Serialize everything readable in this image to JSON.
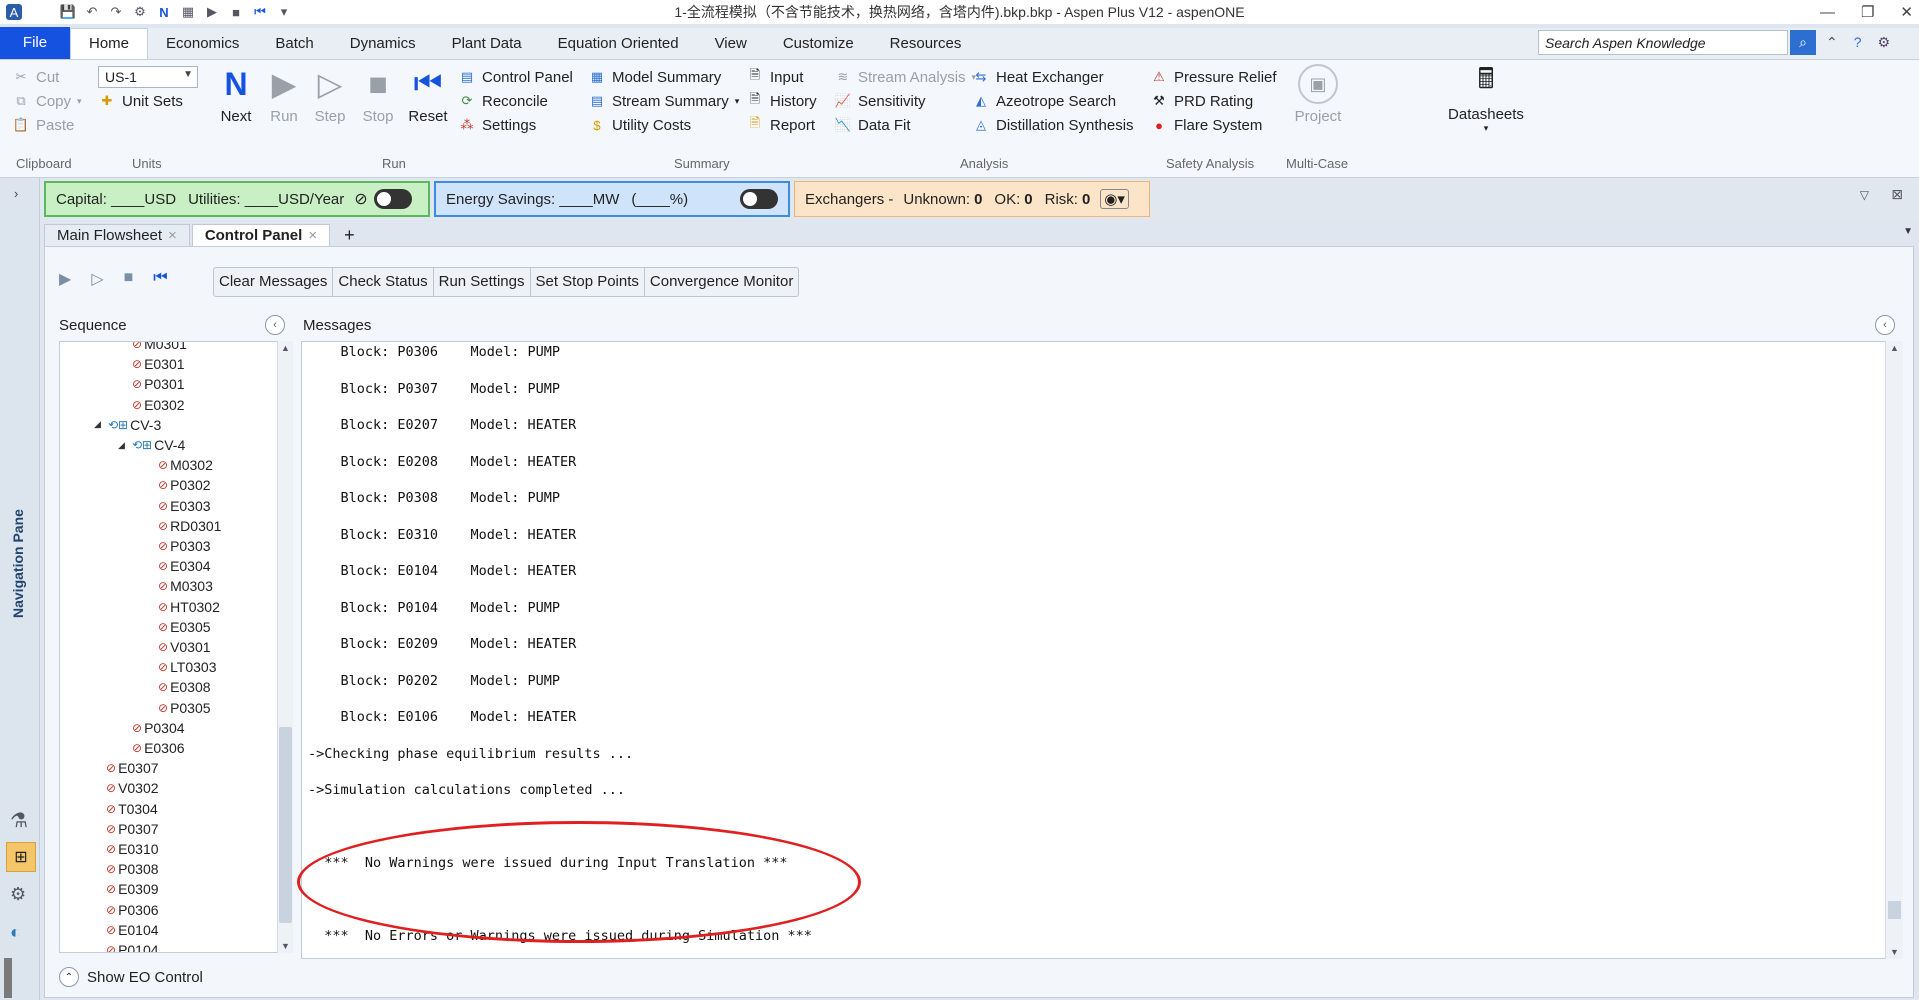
{
  "window": {
    "title": "1-全流程模拟（不含节能技术，换热网络，含塔内件).bkp.bkp - Aspen Plus V12 - aspenONE",
    "controls": [
      "—",
      "❐",
      "✕"
    ]
  },
  "ribbon_tabs": {
    "file": "File",
    "items": [
      "Home",
      "Economics",
      "Batch",
      "Dynamics",
      "Plant Data",
      "Equation Oriented",
      "View",
      "Customize",
      "Resources"
    ],
    "active": "Home"
  },
  "search": {
    "placeholder": "Search Aspen Knowledge"
  },
  "ribbon": {
    "clipboard": {
      "cut": "Cut",
      "copy": "Copy",
      "paste": "Paste",
      "label": "Clipboard"
    },
    "units": {
      "selected": "US-1",
      "unit_sets": "Unit Sets",
      "label": "Units"
    },
    "run": {
      "next": "Next",
      "run": "Run",
      "step": "Step",
      "stop": "Stop",
      "reset": "Reset",
      "control_panel": "Control Panel",
      "reconcile": "Reconcile",
      "settings": "Settings",
      "label": "Run"
    },
    "summary": {
      "model_summary": "Model Summary",
      "stream_summary": "Stream Summary",
      "utility_costs": "Utility Costs",
      "input": "Input",
      "history": "History",
      "report": "Report",
      "label": "Summary"
    },
    "analysis": {
      "stream_analysis": "Stream Analysis",
      "sensitivity": "Sensitivity",
      "data_fit": "Data Fit",
      "heat_exchanger": "Heat Exchanger",
      "azeotrope_search": "Azeotrope Search",
      "distillation_synthesis": "Distillation Synthesis",
      "label": "Analysis"
    },
    "safety": {
      "pressure_relief": "Pressure Relief",
      "prd_rating": "PRD Rating",
      "flare_system": "Flare System",
      "label": "Safety Analysis"
    },
    "multicase": {
      "project": "Project",
      "label": "Multi-Case"
    },
    "datasheets": {
      "label": "Datasheets"
    }
  },
  "energy_bar": {
    "capital": "Capital: ____USD",
    "utilities": "Utilities: ____USD/Year",
    "energy_savings": "Energy Savings: ____MW",
    "percent": "(____%)",
    "exchangers": "Exchangers -",
    "unknown_label": "Unknown:",
    "unknown": "0",
    "ok_label": "OK:",
    "ok": "0",
    "risk_label": "Risk:",
    "risk": "0"
  },
  "nav_pane": {
    "label": "Navigation Pane"
  },
  "doc_tabs": [
    "Main Flowsheet",
    "Control Panel"
  ],
  "panel": {
    "buttons": [
      "Clear Messages",
      "Check Status",
      "Run Settings",
      "Set Stop Points",
      "Convergence Monitor"
    ],
    "sequence_label": "Sequence",
    "messages_label": "Messages",
    "show_eo": "Show EO Control"
  },
  "sequence": [
    {
      "label": "M0301",
      "level": 1,
      "kind": "block"
    },
    {
      "label": "E0301",
      "level": 1,
      "kind": "block"
    },
    {
      "label": "P0301",
      "level": 1,
      "kind": "block"
    },
    {
      "label": "E0302",
      "level": 1,
      "kind": "block"
    },
    {
      "label": "CV-3",
      "level": 0,
      "kind": "loop"
    },
    {
      "label": "CV-4",
      "level": 1,
      "kind": "loop"
    },
    {
      "label": "M0302",
      "level": 2,
      "kind": "block"
    },
    {
      "label": "P0302",
      "level": 2,
      "kind": "block"
    },
    {
      "label": "E0303",
      "level": 2,
      "kind": "block"
    },
    {
      "label": "RD0301",
      "level": 2,
      "kind": "block"
    },
    {
      "label": "P0303",
      "level": 2,
      "kind": "block"
    },
    {
      "label": "E0304",
      "level": 2,
      "kind": "block"
    },
    {
      "label": "M0303",
      "level": 2,
      "kind": "block"
    },
    {
      "label": "HT0302",
      "level": 2,
      "kind": "block"
    },
    {
      "label": "E0305",
      "level": 2,
      "kind": "block"
    },
    {
      "label": "V0301",
      "level": 2,
      "kind": "block"
    },
    {
      "label": "LT0303",
      "level": 2,
      "kind": "block"
    },
    {
      "label": "E0308",
      "level": 2,
      "kind": "block"
    },
    {
      "label": "P0305",
      "level": 2,
      "kind": "block"
    },
    {
      "label": "P0304",
      "level": 1,
      "kind": "block"
    },
    {
      "label": "E0306",
      "level": 1,
      "kind": "block"
    },
    {
      "label": "E0307",
      "level": 0,
      "kind": "block"
    },
    {
      "label": "V0302",
      "level": 0,
      "kind": "block"
    },
    {
      "label": "T0304",
      "level": 0,
      "kind": "block"
    },
    {
      "label": "P0307",
      "level": 0,
      "kind": "block"
    },
    {
      "label": "E0310",
      "level": 0,
      "kind": "block"
    },
    {
      "label": "P0308",
      "level": 0,
      "kind": "block"
    },
    {
      "label": "E0309",
      "level": 0,
      "kind": "block"
    },
    {
      "label": "P0306",
      "level": 0,
      "kind": "block"
    },
    {
      "label": "E0104",
      "level": 0,
      "kind": "block"
    },
    {
      "label": "P0104",
      "level": 0,
      "kind": "block"
    }
  ],
  "messages": [
    "    Block: P0306    Model: PUMP",
    "    Block: P0307    Model: PUMP",
    "    Block: E0207    Model: HEATER",
    "    Block: E0208    Model: HEATER",
    "    Block: P0308    Model: PUMP",
    "    Block: E0310    Model: HEATER",
    "    Block: E0104    Model: HEATER",
    "    Block: P0104    Model: PUMP",
    "    Block: E0209    Model: HEATER",
    "    Block: P0202    Model: PUMP",
    "    Block: E0106    Model: HEATER",
    "->Checking phase equilibrium results ...",
    "->Simulation calculations completed ...",
    "",
    "  ***  No Warnings were issued during Input Translation ***",
    "",
    "  ***  No Errors or Warnings were issued during Simulation ***",
    "->Checking phase equilibrium results ..."
  ]
}
